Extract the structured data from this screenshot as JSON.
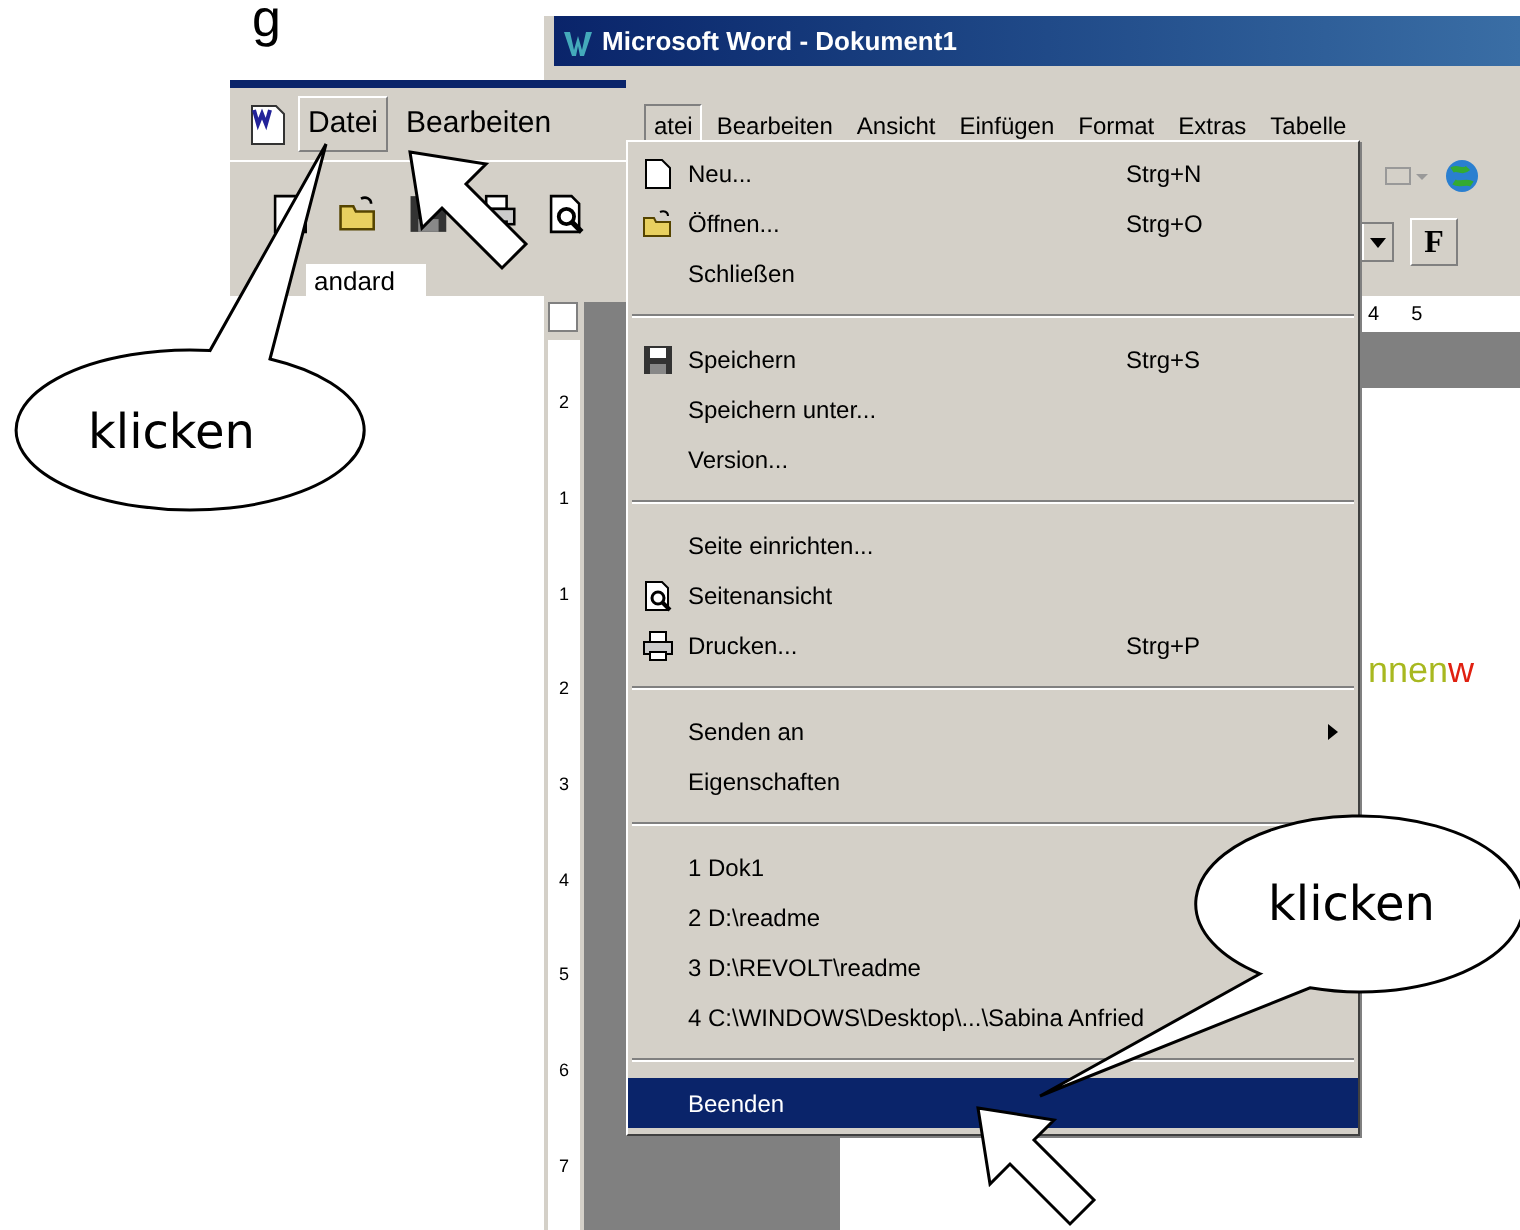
{
  "heading_fragment": "g",
  "snippet": {
    "menu": [
      {
        "label": "Datei",
        "selected": true
      },
      {
        "label": "Bearbeiten",
        "selected": false
      }
    ],
    "style_field": "andard"
  },
  "window": {
    "title": "Microsoft Word - Dokument1"
  },
  "menu_bar": [
    {
      "label": "atei",
      "selected": true
    },
    {
      "label": "Bearbeiten",
      "selected": false
    },
    {
      "label": "Ansicht",
      "selected": false
    },
    {
      "label": "Einfügen",
      "selected": false
    },
    {
      "label": "Format",
      "selected": false
    },
    {
      "label": "Extras",
      "selected": false
    },
    {
      "label": "Tabelle",
      "selected": false
    }
  ],
  "file_menu": [
    {
      "kind": "item",
      "label": "Neu...",
      "shortcut": "Strg+N",
      "selected": false
    },
    {
      "kind": "item",
      "label": "Öffnen...",
      "shortcut": "Strg+O",
      "selected": false
    },
    {
      "kind": "item",
      "label": "Schließen",
      "selected": false
    },
    {
      "kind": "separator"
    },
    {
      "kind": "item",
      "label": "Speichern",
      "shortcut": "Strg+S",
      "selected": false
    },
    {
      "kind": "item",
      "label": "Speichern unter...",
      "selected": false
    },
    {
      "kind": "item",
      "label": "Version...",
      "selected": false
    },
    {
      "kind": "separator"
    },
    {
      "kind": "item",
      "label": "Seite einrichten...",
      "selected": false
    },
    {
      "kind": "item",
      "label": "Seitenansicht",
      "selected": false
    },
    {
      "kind": "item",
      "label": "Drucken...",
      "shortcut": "Strg+P",
      "selected": false
    },
    {
      "kind": "separator"
    },
    {
      "kind": "item",
      "label": "Senden an",
      "submenu": true,
      "selected": false
    },
    {
      "kind": "item",
      "label": "Eigenschaften",
      "selected": false
    },
    {
      "kind": "separator"
    },
    {
      "kind": "item",
      "label": "1 Dok1",
      "selected": false
    },
    {
      "kind": "item",
      "label": "2 D:\\readme",
      "selected": false
    },
    {
      "kind": "item",
      "label": "3 D:\\REVOLT\\readme",
      "selected": false
    },
    {
      "kind": "item",
      "label": "4 C:\\WINDOWS\\Desktop\\...\\Sabina Anfried",
      "selected": false
    },
    {
      "kind": "separator"
    },
    {
      "kind": "item",
      "label": "Beenden",
      "selected": true
    }
  ],
  "toolbar": {
    "bold_button": "F"
  },
  "ruler": {
    "horizontal": [
      "4",
      "5"
    ],
    "vertical": [
      "2",
      "1",
      "1",
      "2",
      "3",
      "4",
      "5",
      "6",
      "7"
    ]
  },
  "document_text": [
    {
      "text": "nnen",
      "color": "#a8b820"
    },
    {
      "text": "w",
      "color": "#e02010"
    }
  ],
  "callouts": [
    {
      "label": "klicken"
    },
    {
      "label": "klicken"
    }
  ]
}
